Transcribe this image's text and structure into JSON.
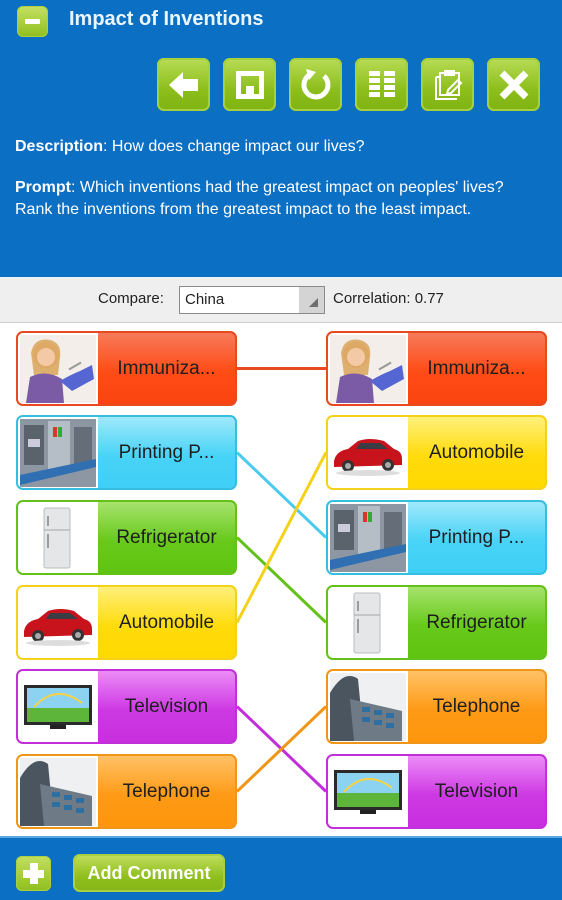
{
  "header": {
    "title": "Impact of Inventions",
    "collapse_icon": "minus-icon",
    "toolbar": [
      {
        "name": "back",
        "icon": "arrow-left-icon"
      },
      {
        "name": "save",
        "icon": "floppy-disk-icon"
      },
      {
        "name": "refresh",
        "icon": "refresh-icon"
      },
      {
        "name": "columns",
        "icon": "columns-icon"
      },
      {
        "name": "edit-notes",
        "icon": "clipboard-edit-icon"
      },
      {
        "name": "close",
        "icon": "close-icon"
      }
    ],
    "description_label": "Description",
    "description_text": ": How does change impact our lives?",
    "prompt_label": "Prompt",
    "prompt_text": ": Which inventions had the greatest impact on peoples' lives? Rank the inventions from the greatest impact to the least impact."
  },
  "compare": {
    "label": "Compare:",
    "selected": "China",
    "correlation": "Correlation: 0.77"
  },
  "left_ranking": [
    {
      "label": "Immuniza...",
      "color": "red",
      "image": "child-vaccination"
    },
    {
      "label": "Printing P...",
      "color": "cyan",
      "image": "printing-press-machinery"
    },
    {
      "label": "Refrigerator",
      "color": "green",
      "image": "refrigerator"
    },
    {
      "label": "Automobile",
      "color": "yellow",
      "image": "red-car"
    },
    {
      "label": "Television",
      "color": "purple",
      "image": "television"
    },
    {
      "label": "Telephone",
      "color": "orange",
      "image": "desk-telephone"
    }
  ],
  "right_ranking": [
    {
      "label": "Immuniza...",
      "color": "red",
      "image": "child-vaccination"
    },
    {
      "label": "Automobile",
      "color": "yellow",
      "image": "red-car"
    },
    {
      "label": "Printing P...",
      "color": "cyan",
      "image": "printing-press-machinery"
    },
    {
      "label": "Refrigerator",
      "color": "green",
      "image": "refrigerator"
    },
    {
      "label": "Telephone",
      "color": "orange",
      "image": "desk-telephone"
    },
    {
      "label": "Television",
      "color": "purple",
      "image": "television"
    }
  ],
  "connections": [
    {
      "from": 0,
      "to": 0,
      "color": "#e64a1e"
    },
    {
      "from": 1,
      "to": 2,
      "color": "#4cc9ee"
    },
    {
      "from": 2,
      "to": 3,
      "color": "#64c11a"
    },
    {
      "from": 3,
      "to": 1,
      "color": "#f5d21a"
    },
    {
      "from": 4,
      "to": 5,
      "color": "#c12fd8"
    },
    {
      "from": 5,
      "to": 4,
      "color": "#ef9619"
    }
  ],
  "footer": {
    "add_icon": "plus-icon",
    "add_comment_label": "Add Comment"
  },
  "colors": {
    "header_blue": "#0b6fc3",
    "button_green": "#8fbf1e"
  }
}
